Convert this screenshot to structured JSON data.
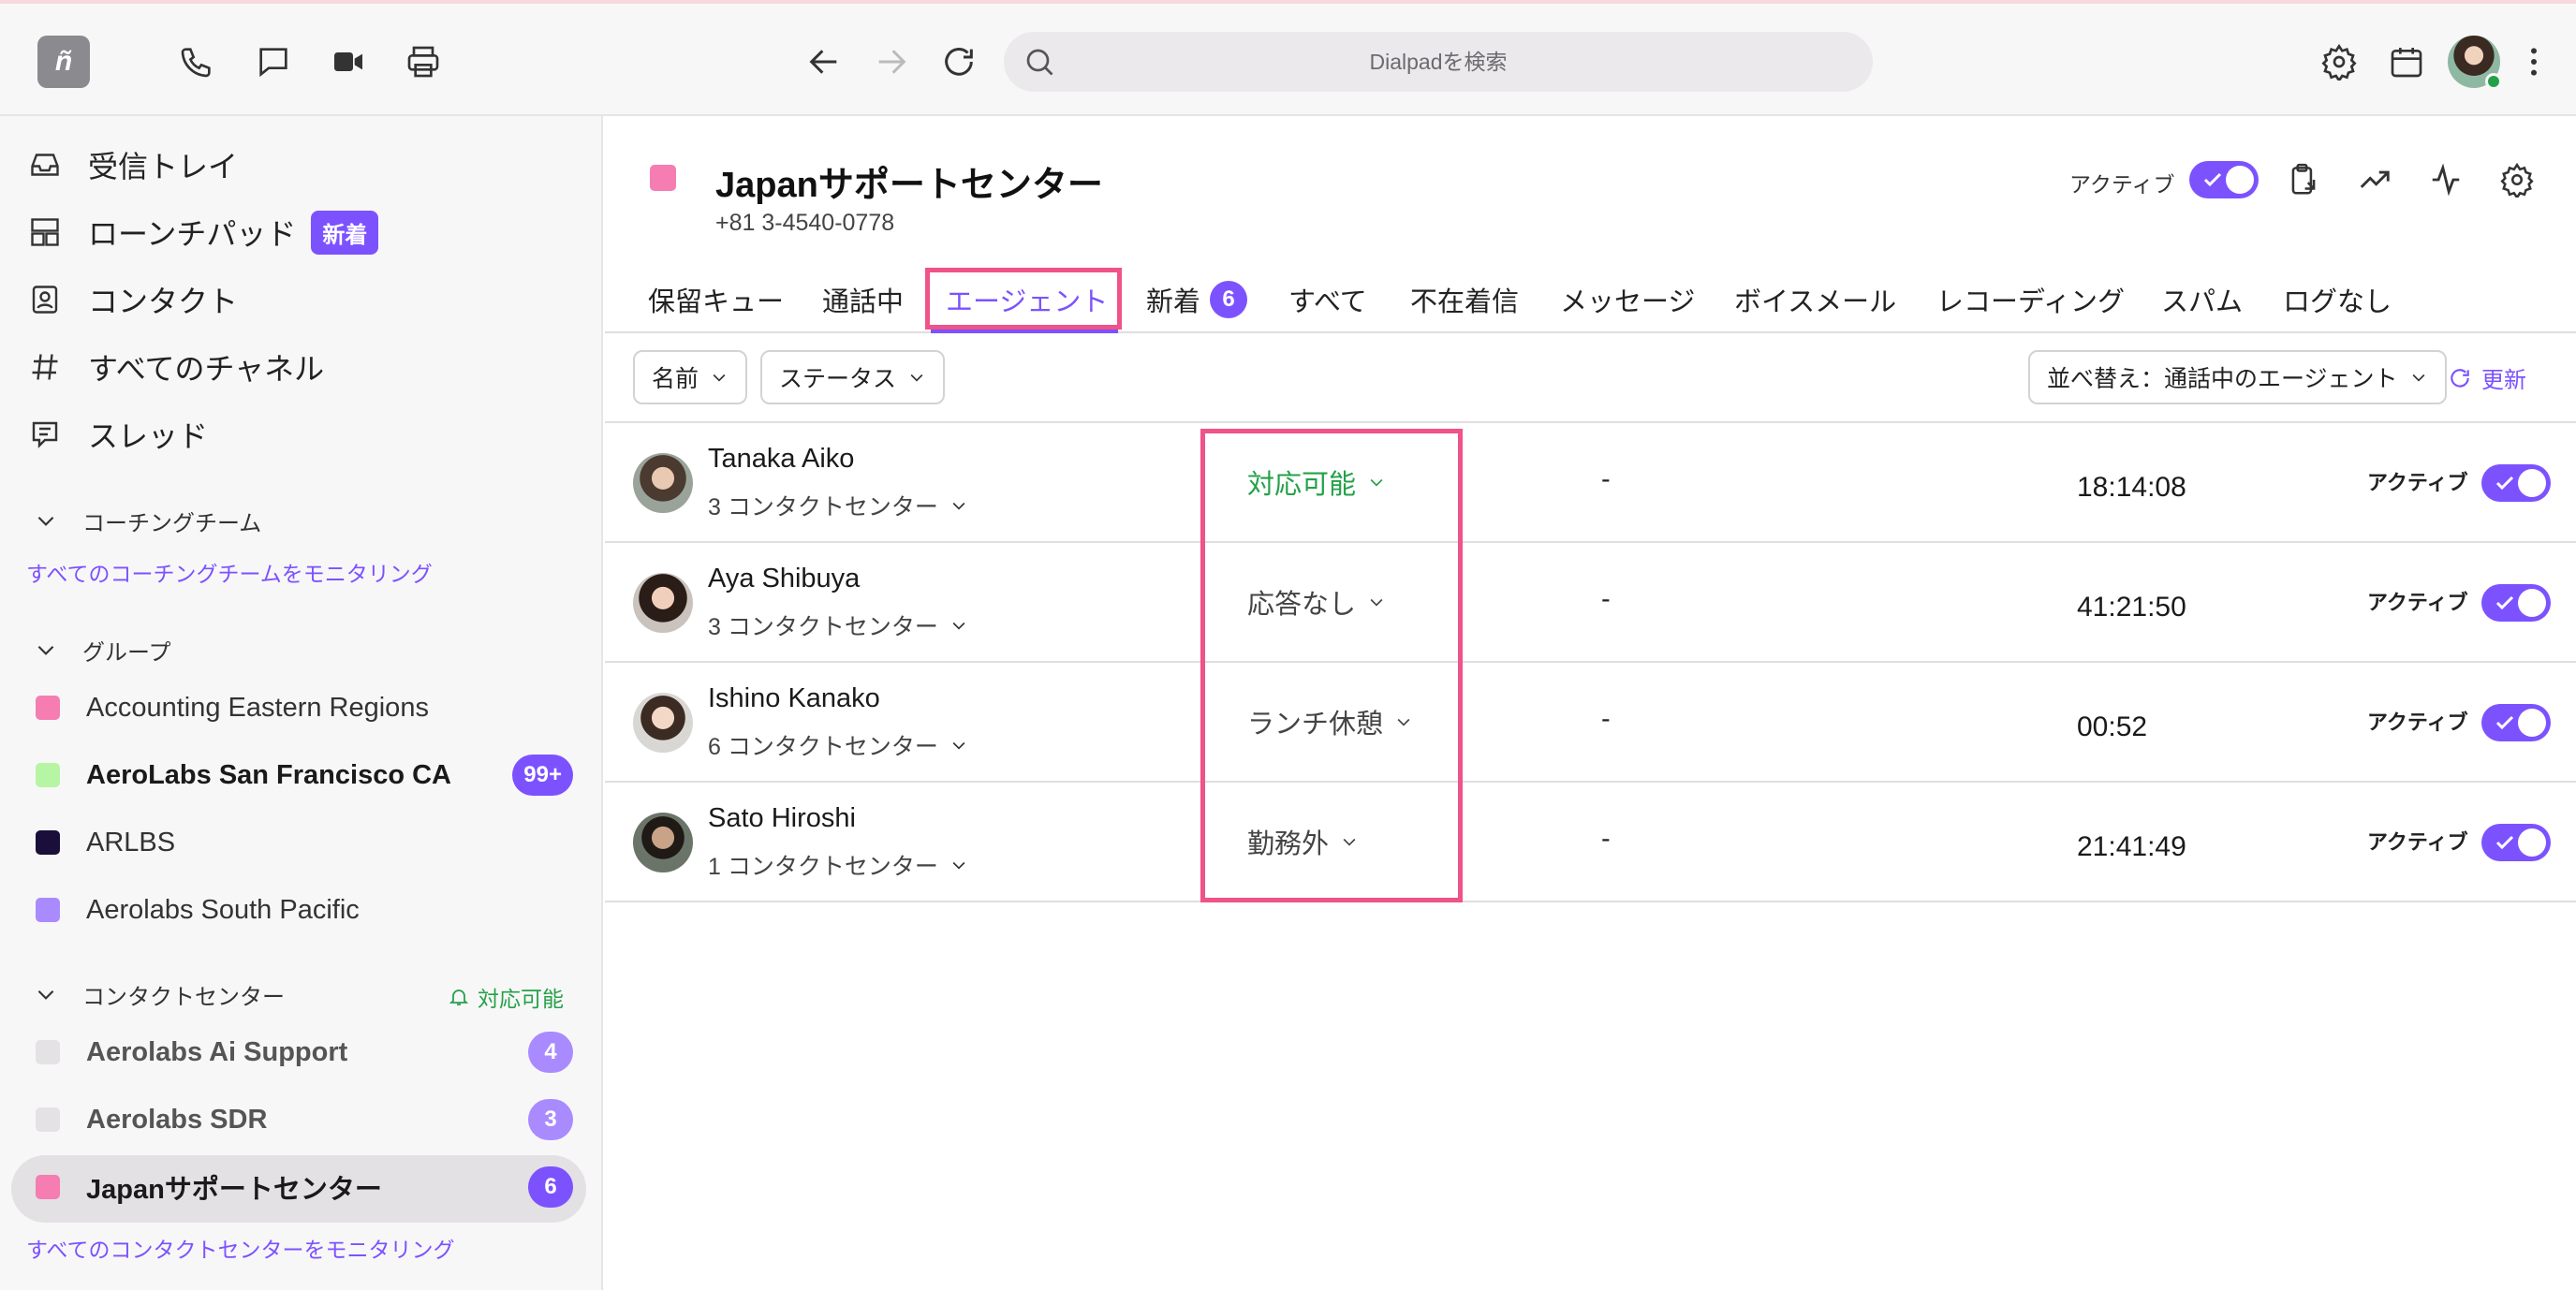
{
  "app": {
    "logo_text": "ñ"
  },
  "search": {
    "placeholder": "Dialpadを検索"
  },
  "sidebar": {
    "nav": [
      {
        "label": "受信トレイ",
        "icon": "inbox-icon"
      },
      {
        "label": "ローンチパッド",
        "icon": "launchpad-icon",
        "badge": "新着"
      },
      {
        "label": "コンタクト",
        "icon": "contact-icon"
      },
      {
        "label": "すべてのチャネル",
        "icon": "hash-icon"
      },
      {
        "label": "スレッド",
        "icon": "thread-icon"
      }
    ],
    "coaching": {
      "title": "コーチングチーム",
      "link": "すべてのコーチングチームをモニタリング"
    },
    "groups": {
      "title": "グループ",
      "items": [
        {
          "label": "Accounting Eastern Regions",
          "color": "#f57db2"
        },
        {
          "label": "AeroLabs San Francisco CA",
          "color": "#b6f5a3",
          "count": "99+"
        },
        {
          "label": "ARLBS",
          "color": "#1a0f3a"
        },
        {
          "label": "Aerolabs South Pacific",
          "color": "#a98bff"
        }
      ]
    },
    "contact_centers": {
      "title": "コンタクトセンター",
      "status": "対応可能",
      "items": [
        {
          "label": "Aerolabs Ai Support",
          "color": "#e4e2e4",
          "count": "4"
        },
        {
          "label": "Aerolabs SDR",
          "color": "#e4e2e4",
          "count": "3"
        },
        {
          "label": "Japanサポートセンター",
          "color": "#f57db2",
          "count": "6"
        }
      ],
      "link": "すべてのコンタクトセンターをモニタリング"
    }
  },
  "header": {
    "title": "Japanサポートセンター",
    "phone": "+81 3-4540-0778",
    "active_label": "アクティブ",
    "color": "#f57db2"
  },
  "tabs": [
    {
      "label": "保留キュー"
    },
    {
      "label": "通話中"
    },
    {
      "label": "エージェント",
      "selected": true
    },
    {
      "label": "新着",
      "badge": "6"
    },
    {
      "label": "すべて"
    },
    {
      "label": "不在着信"
    },
    {
      "label": "メッセージ"
    },
    {
      "label": "ボイスメール"
    },
    {
      "label": "レコーディング"
    },
    {
      "label": "スパム"
    },
    {
      "label": "ログなし"
    }
  ],
  "filters": {
    "name": "名前",
    "status": "ステータス",
    "sort": "並べ替え：通話中のエージェント",
    "refresh": "更新"
  },
  "agents": [
    {
      "name": "Tanaka Aiko",
      "centers": "3 コンタクトセンター",
      "status": "対応可能",
      "status_color": "#24a148",
      "calls": "-",
      "time": "18:14:08",
      "active_label": "アクティブ"
    },
    {
      "name": "Aya Shibuya",
      "centers": "3 コンタクトセンター",
      "status": "応答なし",
      "status_color": "#444444",
      "calls": "-",
      "time": "41:21:50",
      "active_label": "アクティブ"
    },
    {
      "name": "Ishino Kanako",
      "centers": "6 コンタクトセンター",
      "status": "ランチ休憩",
      "status_color": "#444444",
      "calls": "-",
      "time": "00:52",
      "active_label": "アクティブ"
    },
    {
      "name": "Sato Hiroshi",
      "centers": "1 コンタクトセンター",
      "status": "勤務外",
      "status_color": "#444444",
      "calls": "-",
      "time": "21:41:49",
      "active_label": "アクティブ"
    }
  ],
  "accent": "#7c52ff"
}
